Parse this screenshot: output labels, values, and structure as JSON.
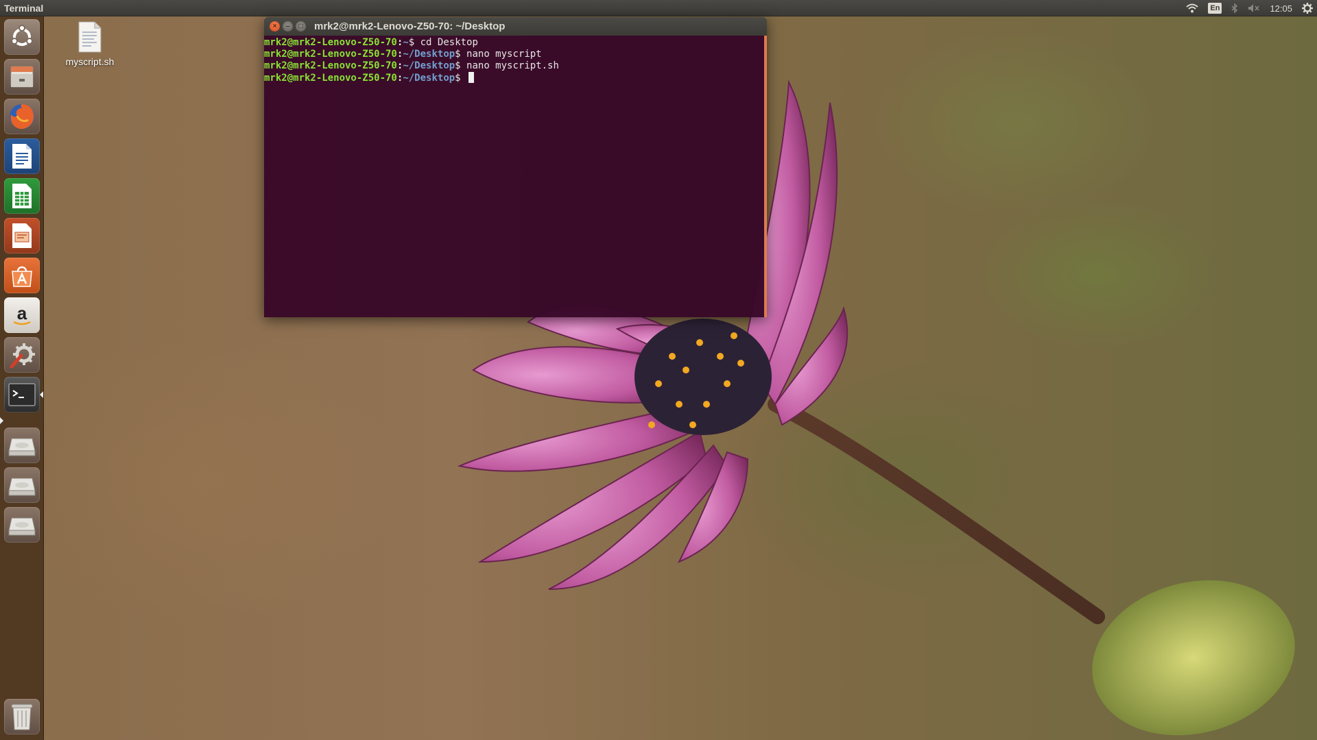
{
  "top_panel": {
    "app_title": "Terminal",
    "keyboard_layout": "En",
    "clock": "12:05"
  },
  "launcher": {
    "items": [
      {
        "name": "dash-home",
        "icon": "ubuntu-logo-icon"
      },
      {
        "name": "files",
        "icon": "file-cabinet-icon"
      },
      {
        "name": "firefox",
        "icon": "firefox-icon"
      },
      {
        "name": "libreoffice-writer",
        "icon": "writer-icon"
      },
      {
        "name": "libreoffice-calc",
        "icon": "calc-icon"
      },
      {
        "name": "libreoffice-impress",
        "icon": "impress-icon"
      },
      {
        "name": "ubuntu-software-center",
        "icon": "software-center-icon"
      },
      {
        "name": "amazon",
        "icon": "amazon-icon"
      },
      {
        "name": "system-settings",
        "icon": "settings-icon"
      },
      {
        "name": "terminal",
        "icon": "terminal-icon",
        "active": true
      },
      {
        "name": "drive-1",
        "icon": "drive-icon"
      },
      {
        "name": "drive-2",
        "icon": "drive-icon"
      },
      {
        "name": "drive-3",
        "icon": "drive-icon"
      },
      {
        "name": "trash",
        "icon": "trash-icon"
      }
    ]
  },
  "desktop": {
    "icons": [
      {
        "label": "myscript.sh",
        "icon": "text-file-icon"
      }
    ]
  },
  "terminal": {
    "title": "mrk2@mrk2-Lenovo-Z50-70: ~/Desktop",
    "lines": [
      {
        "user": "mrk2@mrk2-Lenovo-Z50-70",
        "path": "~",
        "command": " cd Desktop"
      },
      {
        "user": "mrk2@mrk2-Lenovo-Z50-70",
        "path": "~/Desktop",
        "command": " nano myscript"
      },
      {
        "user": "mrk2@mrk2-Lenovo-Z50-70",
        "path": "~/Desktop",
        "command": " nano myscript.sh"
      },
      {
        "user": "mrk2@mrk2-Lenovo-Z50-70",
        "path": "~/Desktop",
        "command": " "
      }
    ],
    "colors": {
      "background": "#380828",
      "user": "#8ae234",
      "path": "#729fcf",
      "text": "#e6e6e6"
    }
  },
  "window_buttons": {
    "close": "×",
    "minimize": "–",
    "maximize": "□"
  }
}
